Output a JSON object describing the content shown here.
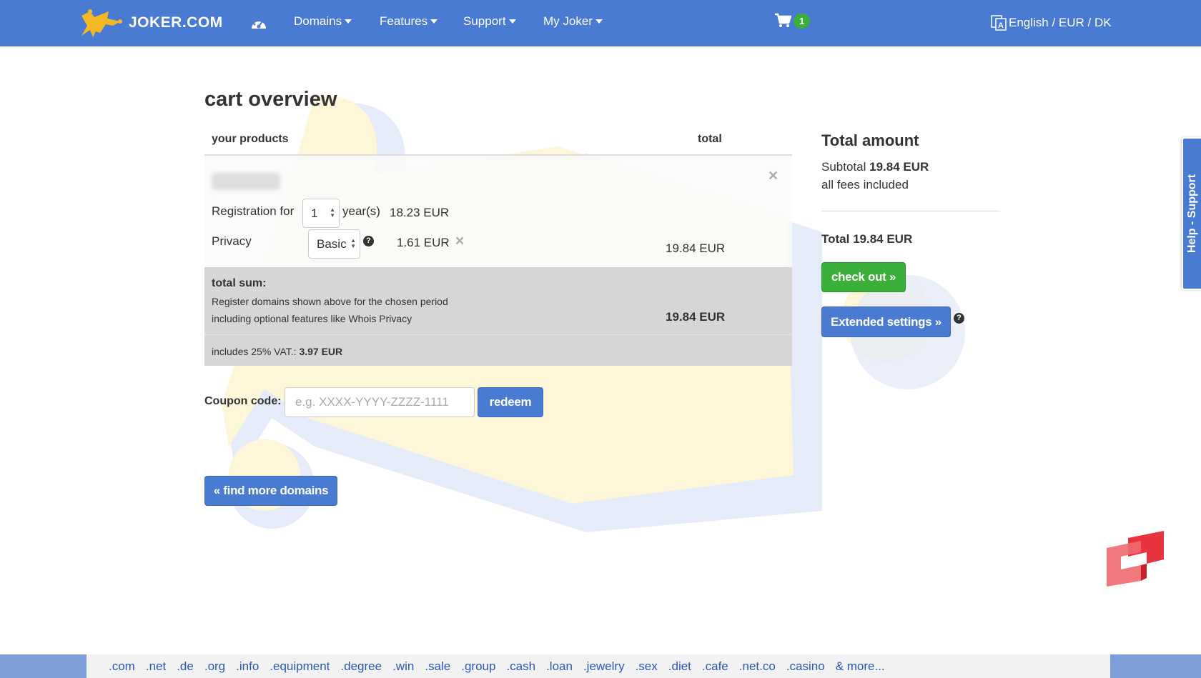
{
  "nav": {
    "brand": "JOKER.COM",
    "items": [
      {
        "label": "Domains"
      },
      {
        "label": "Features"
      },
      {
        "label": "Support"
      },
      {
        "label": "My Joker"
      }
    ],
    "cart_count": "1",
    "locale": "English / EUR / DK"
  },
  "page": {
    "title": "cart overview"
  },
  "cart": {
    "col_products": "your products",
    "col_total": "total",
    "registration_label": "Registration for",
    "registration_years": "1",
    "years_label": "year(s)",
    "registration_price": "18.23 EUR",
    "privacy_label": "Privacy",
    "privacy_option": "Basic",
    "privacy_price": "1.61 EUR",
    "row_total": "19.84 EUR",
    "sum_title": "total sum:",
    "sum_line1": "Register domains shown above for the chosen period",
    "sum_line2": "including optional features like Whois Privacy",
    "sum_total": "19.84 EUR",
    "vat_text": "includes 25% VAT.: ",
    "vat_amount": "3.97 EUR"
  },
  "coupon": {
    "label": "Coupon code:",
    "placeholder": "e.g. XXXX-YYYY-ZZZZ-1111",
    "button": "redeem"
  },
  "find_more": "« find more domains",
  "summary": {
    "title": "Total amount",
    "subtotal_label": "Subtotal ",
    "subtotal_value": "19.84 EUR",
    "fees": "all fees included",
    "total_label": "Total ",
    "total_value": "19.84 EUR",
    "checkout": "check out »",
    "extended": "Extended settings »"
  },
  "side_tab": "Help - Support",
  "tlds": [
    ".com",
    ".net",
    ".de",
    ".org",
    ".info",
    ".equipment",
    ".degree",
    ".win",
    ".sale",
    ".group",
    ".cash",
    ".loan",
    ".jewelry",
    ".sex",
    ".diet",
    ".cafe",
    ".net.co",
    ".casino",
    "& more..."
  ],
  "colors": {
    "nav_bg": "#4a7bd3",
    "accent_green": "#3aaf3a",
    "link_blue": "#2b56b8"
  }
}
